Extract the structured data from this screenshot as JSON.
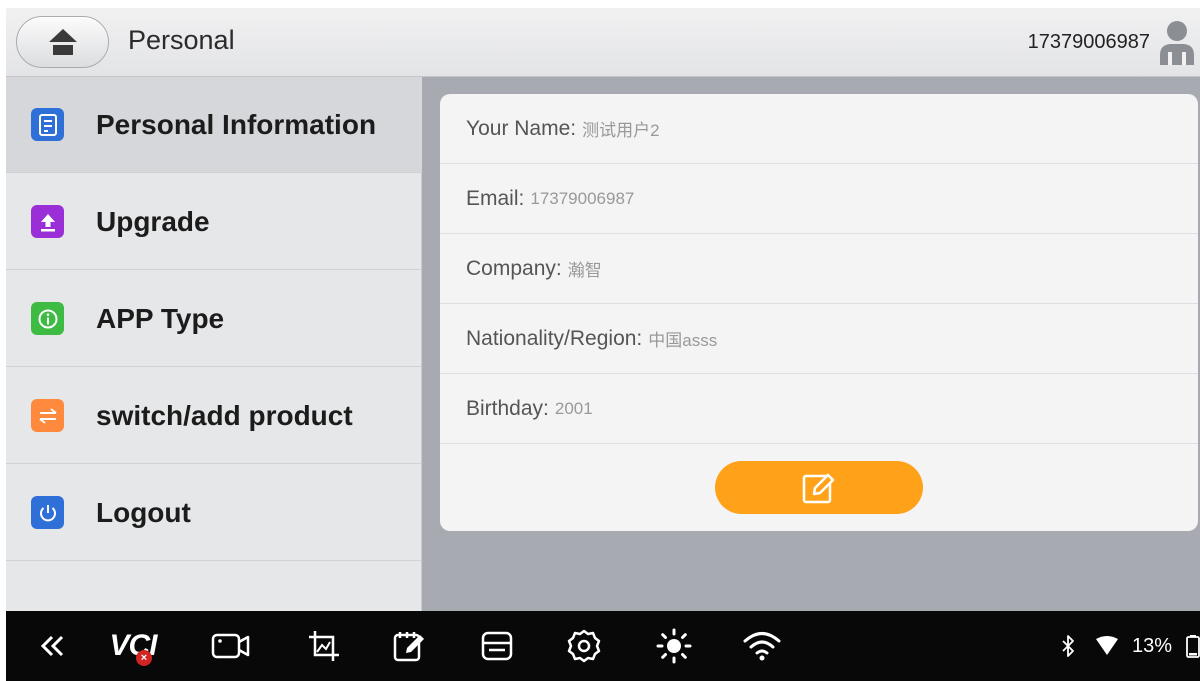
{
  "header": {
    "title": "Personal",
    "account_id": "17379006987",
    "home_icon": "home-icon",
    "avatar_icon": "user-avatar-icon"
  },
  "sidebar": {
    "items": [
      {
        "label": "Personal Information",
        "icon": "document-icon",
        "color": "#2f6fd8",
        "active": true
      },
      {
        "label": "Upgrade",
        "icon": "upload-icon",
        "color": "#9a2fd8",
        "active": false
      },
      {
        "label": "APP Type",
        "icon": "info-icon",
        "color": "#3dbb43",
        "active": false
      },
      {
        "label": "switch/add product",
        "icon": "switch-icon",
        "color": "#ff8a3d",
        "active": false
      },
      {
        "label": "Logout",
        "icon": "power-icon",
        "color": "#2f6fd8",
        "active": false
      }
    ]
  },
  "profile": {
    "fields": [
      {
        "label": "Your Name:",
        "value": "测试用户2"
      },
      {
        "label": "Email:",
        "value": "17379006987"
      },
      {
        "label": "Company:",
        "value": "瀚智"
      },
      {
        "label": "Nationality/Region:",
        "value": "中国asss"
      },
      {
        "label": "Birthday:",
        "value": "2001"
      }
    ],
    "edit_icon": "edit-icon",
    "edit_color": "#ffa21a"
  },
  "navbar": {
    "vci_label": "VCI",
    "vci_status": "×",
    "battery": "13%",
    "icons": [
      "back-icon",
      "vci-icon",
      "video-icon",
      "screenshot-icon",
      "notes-icon",
      "storage-icon",
      "settings-icon",
      "brightness-icon",
      "wifi-icon",
      "bluetooth-icon",
      "signal-icon",
      "battery-icon"
    ]
  }
}
